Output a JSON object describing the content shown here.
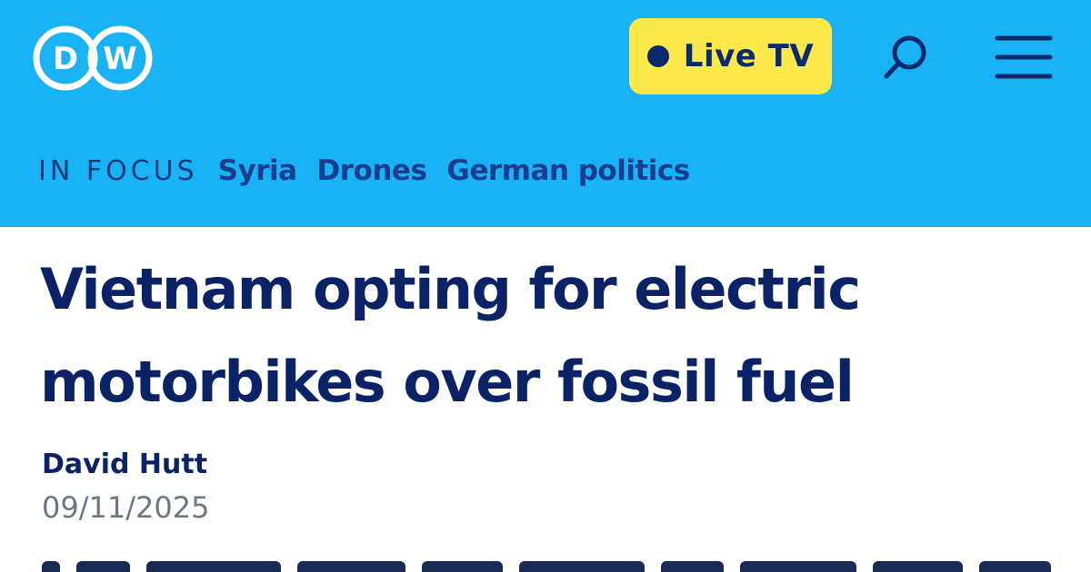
{
  "header": {
    "logo_text": "DW",
    "live_tv_label": "Live TV",
    "search_icon": "search-icon",
    "menu_icon": "hamburger-menu-icon",
    "background_color": "#19b3f5",
    "live_tv_color": "#fbe84a"
  },
  "in_focus": {
    "label": "IN FOCUS",
    "links": [
      "Syria",
      "Drones",
      "German politics"
    ]
  },
  "article": {
    "headline": "Vietnam opting for electric motorbikes over fossil fuel",
    "author": "David Hutt",
    "date": "09/11/2025"
  }
}
